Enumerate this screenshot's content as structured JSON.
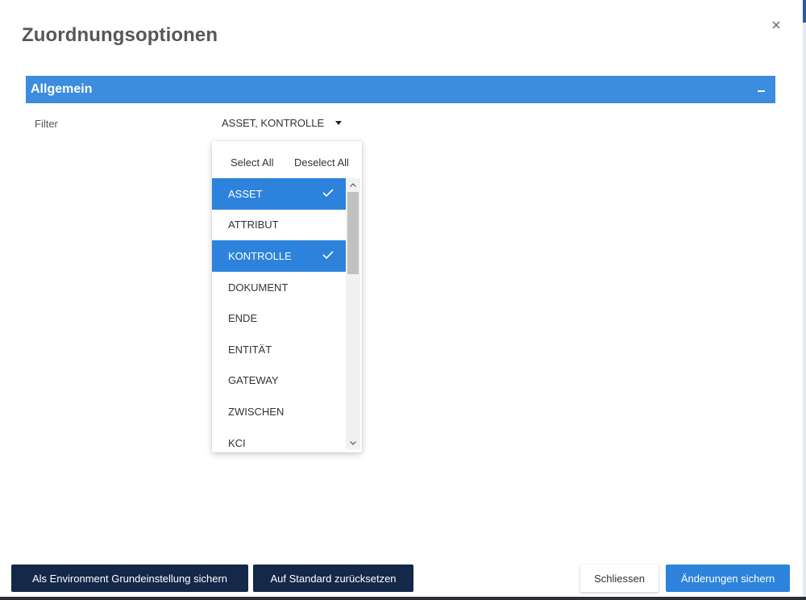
{
  "dialog": {
    "title": "Zuordnungsoptionen",
    "close_label": "×"
  },
  "section": {
    "title": "Allgemein",
    "collapse_label": "collapse"
  },
  "filter": {
    "label": "Filter",
    "value": "ASSET, KONTROLLE"
  },
  "dropdown": {
    "select_all": "Select All",
    "deselect_all": "Deselect All",
    "options": [
      {
        "label": "ASSET",
        "selected": true
      },
      {
        "label": "ATTRIBUT",
        "selected": false
      },
      {
        "label": "KONTROLLE",
        "selected": true
      },
      {
        "label": "DOKUMENT",
        "selected": false
      },
      {
        "label": "ENDE",
        "selected": false
      },
      {
        "label": "ENTITÄT",
        "selected": false
      },
      {
        "label": "GATEWAY",
        "selected": false
      },
      {
        "label": "ZWISCHEN",
        "selected": false
      },
      {
        "label": "KCI",
        "selected": false
      }
    ]
  },
  "footer": {
    "save_environment": "Als Environment Grundeinstellung sichern",
    "reset_default": "Auf Standard zurücksetzen",
    "close": "Schliessen",
    "save_changes": "Änderungen sichern"
  },
  "colors": {
    "section_header": "#3c8ce0",
    "selected_item": "#2d83dc",
    "dark_button": "#14284a",
    "primary_button": "#2d83dc"
  },
  "icons": {
    "close": "close-icon",
    "collapse": "minus-icon",
    "caret": "caret-down-icon",
    "check": "check-icon",
    "scroll_up": "chevron-up-icon",
    "scroll_down": "chevron-down-icon"
  }
}
